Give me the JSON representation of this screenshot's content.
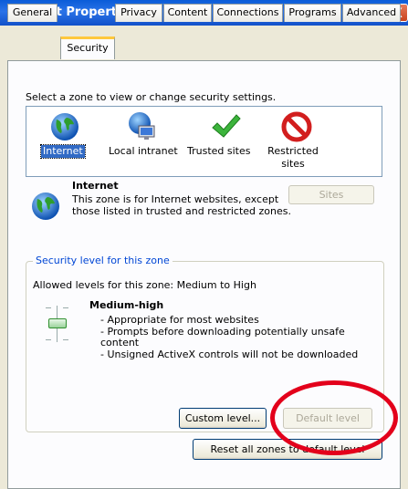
{
  "window": {
    "title": "Internet Properties",
    "help_label": "?",
    "close_label": "X"
  },
  "tabs": [
    {
      "label": "General"
    },
    {
      "label": "Security",
      "active": true
    },
    {
      "label": "Privacy"
    },
    {
      "label": "Content"
    },
    {
      "label": "Connections"
    },
    {
      "label": "Programs"
    },
    {
      "label": "Advanced"
    }
  ],
  "zones": {
    "prompt": "Select a zone to view or change security settings.",
    "items": [
      {
        "label": "Internet",
        "icon": "globe-icon",
        "selected": true
      },
      {
        "label": "Local intranet",
        "icon": "intranet-icon"
      },
      {
        "label": "Trusted sites",
        "icon": "checkmark-icon"
      },
      {
        "label": "Restricted sites",
        "icon": "restricted-icon"
      }
    ]
  },
  "zone_info": {
    "title": "Internet",
    "description": "This zone is for Internet websites, except those listed in trusted and restricted zones.",
    "sites_button": "Sites"
  },
  "security_level": {
    "legend": "Security level for this zone",
    "allowed": "Allowed levels for this zone: Medium to High",
    "level_name": "Medium-high",
    "bullets": [
      "- Appropriate for most websites",
      "- Prompts before downloading potentially unsafe content",
      "- Unsigned ActiveX controls will not be downloaded"
    ],
    "custom_button": "Custom level...",
    "default_button": "Default level"
  },
  "reset_button": "Reset all zones to default level",
  "colors": {
    "titlebar": "#0a5cd8",
    "tab_highlight": "#ffc83c",
    "selection": "#316ac5",
    "annotation": "#e3001b"
  }
}
